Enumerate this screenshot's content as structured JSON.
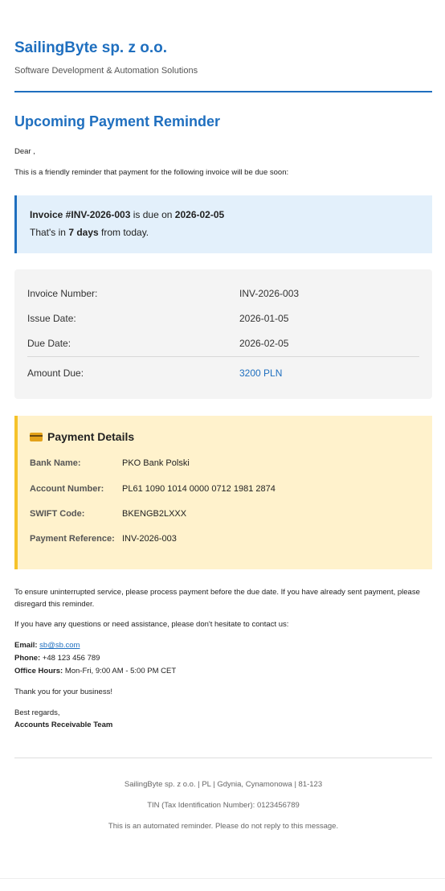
{
  "header": {
    "company": "SailingByte sp. z o.o.",
    "tagline": "Software Development & Automation Solutions"
  },
  "title": "Upcoming Payment Reminder",
  "greeting": "Dear ,",
  "intro": "This is a friendly reminder that payment for the following invoice will be due soon:",
  "notice": {
    "invoice_label": "Invoice #INV-2026-003",
    "due_text": " is due on ",
    "due_date": "2026-02-05",
    "days_prefix": "That's in ",
    "days": "7 days",
    "days_suffix": " from today."
  },
  "details": {
    "invoice_number_label": "Invoice Number:",
    "invoice_number": "INV-2026-003",
    "issue_date_label": "Issue Date:",
    "issue_date": "2026-01-05",
    "due_date_label": "Due Date:",
    "due_date": "2026-02-05",
    "amount_label": "Amount Due:",
    "amount": "3200 PLN"
  },
  "payment": {
    "heading": "Payment Details",
    "icon": "credit-card-icon",
    "bank_label": "Bank Name:",
    "bank": "PKO Bank Polski",
    "account_label": "Account Number:",
    "account": "PL61 1090 1014 0000 0712 1981 2874",
    "swift_label": "SWIFT Code:",
    "swift": "BKENGB2LXXX",
    "reference_label": "Payment Reference:",
    "reference": "INV-2026-003"
  },
  "body": {
    "ensure": "To ensure uninterrupted service, please process payment before the due date. If you have already sent payment, please disregard this reminder.",
    "questions": "If you have any questions or need assistance, please don't hesitate to contact us:"
  },
  "contact": {
    "email_label": "Email:",
    "email": "sb@sb.com",
    "phone_label": "Phone:",
    "phone": " +48 123 456 789",
    "hours_label": "Office Hours:",
    "hours": " Mon-Fri, 9:00 AM - 5:00 PM CET"
  },
  "closing": {
    "thanks": "Thank you for your business!",
    "regards": "Best regards,",
    "team": "Accounts Receivable Team"
  },
  "footer": {
    "address": "SailingByte sp. z o.o. | PL | Gdynia, Cynamonowa | 81-123",
    "tin": "TIN (Tax Identification Number): 0123456789",
    "automated": "This is an automated reminder. Please do not reply to this message."
  },
  "colors": {
    "accent": "#1f6fbf",
    "notice_bg": "#e3f0fb",
    "payment_bg": "#fff2cc",
    "payment_border": "#f5c22a"
  }
}
